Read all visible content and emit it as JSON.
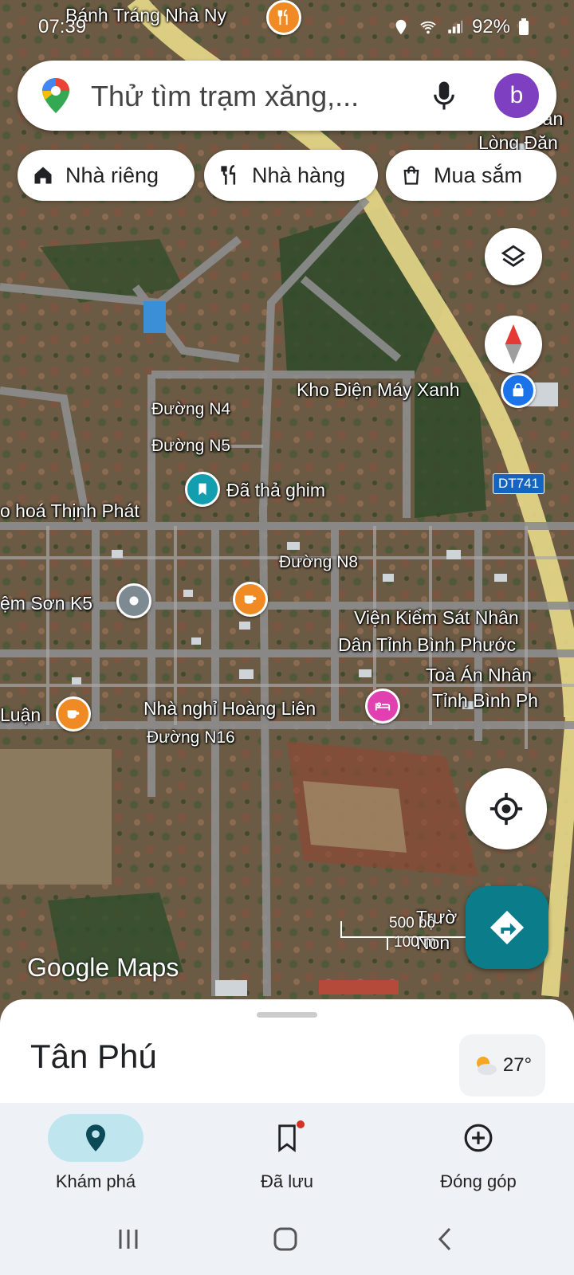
{
  "status_bar": {
    "time": "07:39",
    "battery": "92%"
  },
  "search": {
    "placeholder": "Thử tìm trạm xăng,...",
    "avatar_letter": "b"
  },
  "chips": [
    {
      "label": "Nhà riêng",
      "icon": "home-icon"
    },
    {
      "label": "Nhà hàng",
      "icon": "restaurant-icon"
    },
    {
      "label": "Mua sắm",
      "icon": "shopping-bag-icon"
    }
  ],
  "map": {
    "labels": {
      "top_shop": "Bánh Tráng Nhà Ny",
      "top_right_1": "Quán",
      "top_right_2": "Lòng Đăn",
      "electronics": "Kho Điện Máy Xanh",
      "road_n4": "Đường N4",
      "road_n5": "Đường N5",
      "pin_dropped": "Đã thả ghim",
      "road_dt741": "DT741",
      "thinh_phat": "o hoá Thịnh Phát",
      "road_n8": "Đường N8",
      "son_k5": "ệm Sơn K5",
      "procuracy_1": "Viện Kiểm Sát Nhân",
      "procuracy_2": "Dân Tỉnh Bình Phước",
      "court_1": "Toà Án Nhân",
      "court_2": "Tỉnh Bình Ph",
      "luan": "Luận",
      "guesthouse": "Nhà nghỉ Hoàng Liên",
      "road_n16": "Đường N16",
      "school_1": "Trườ",
      "school_2": "Non"
    },
    "scale": {
      "ft": "500 bộ",
      "m": "100 m"
    },
    "watermark": "Google Maps"
  },
  "sheet": {
    "place": "Tân Phú",
    "temperature": "27°"
  },
  "bottom_nav": [
    {
      "label": "Khám phá",
      "icon": "explore-pin-icon",
      "active": true
    },
    {
      "label": "Đã lưu",
      "icon": "bookmark-icon",
      "active": false
    },
    {
      "label": "Đóng góp",
      "icon": "add-circle-icon",
      "active": false
    }
  ],
  "colors": {
    "accent": "#0b7d8a",
    "avatar": "#7e3fc1",
    "active_tab": "#bfe6ef"
  }
}
